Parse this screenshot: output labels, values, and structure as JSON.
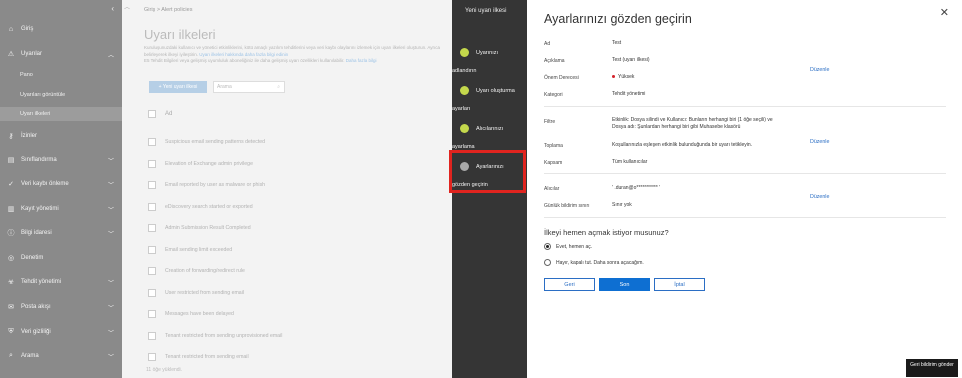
{
  "nav": {
    "items": [
      {
        "icon": "home-icon",
        "glyph": "⌂",
        "label": "Giriş"
      },
      {
        "icon": "warning-icon",
        "glyph": "⚠",
        "label": "Uyarılar"
      },
      {
        "icon": "permissions-icon",
        "glyph": "⚷",
        "label": "İzinler"
      },
      {
        "icon": "classification-icon",
        "glyph": "▤",
        "label": "Sınıflandırma"
      },
      {
        "icon": "loss-prevention-icon",
        "glyph": "✓",
        "label": "Veri kaybı önleme"
      },
      {
        "icon": "records-icon",
        "glyph": "▥",
        "label": "Kayıt yönetimi"
      },
      {
        "icon": "info-governance-icon",
        "glyph": "ⓘ",
        "label": "Bilgi idaresi"
      },
      {
        "icon": "audit-icon",
        "glyph": "◎",
        "label": "Denetim"
      },
      {
        "icon": "threat-icon",
        "glyph": "☣",
        "label": "Tehdit yönetimi"
      },
      {
        "icon": "mail-flow-icon",
        "glyph": "✉",
        "label": "Posta akışı"
      },
      {
        "icon": "privacy-icon",
        "glyph": "⛨",
        "label": "Veri gizliliği"
      },
      {
        "icon": "search-icon",
        "glyph": "⌕",
        "label": "Arama"
      }
    ],
    "sub": [
      "Pano",
      "Uyarıları görüntüle",
      "Uyarı ilkeleri"
    ]
  },
  "main": {
    "breadcrumb": "Giriş  >  Alert policies",
    "title": "Uyarı ilkeleri",
    "desc1": "Kuruluşunuzdaki kullanıcı ve yönetici etkinliklerini, kötü amaçlı yazılım tehditlerini veya veri kaybı olaylarını izlemek için uyarı ilkeleri oluşturun. Ayrıca",
    "desc2": "belirleyerek ilkeyi iyileştirin.",
    "desc_link1": "Uyarı ilkeleri hakkında daha fazla bilgi edinin",
    "desc3": "E5 Tehdit Bilgileri veya gelişmiş uyumluluk aboneliğiniz ile daha gelişmiş uyarı özellikleri kullanılabilir.",
    "desc_link2": "Daha fazla bilgi",
    "new_button": "+ Yeni uyarı ilkesi",
    "search_placeholder": "Arama",
    "column": "Ad",
    "rows": [
      "Suspicious email sending patterns detected",
      "Elevation of Exchange admin privilege",
      "Email reported by user as malware or phish",
      "eDiscovery search started or exported",
      "Admin Submission Result Completed",
      "Email sending limit exceeded",
      "Creation of forwarding/redirect rule",
      "User restricted from sending email",
      "Messages have been delayed",
      "Tenant restricted from sending unprovisioned email",
      "Tenant restricted from sending email"
    ],
    "count": "11 öğe yüklendi."
  },
  "wizard": {
    "title": "Yeni uyarı ilkesi",
    "steps": [
      {
        "label": "Uyarınızı",
        "tail": "adlandırın"
      },
      {
        "label": "Uyarı oluşturma",
        "tail": "ayarları"
      },
      {
        "label": "Alıcılarınızı",
        "tail": "ayarlama"
      },
      {
        "label": "Ayarlarınızı",
        "tail": "gözden geçirin"
      }
    ]
  },
  "review": {
    "title": "Ayarlarınızı gözden geçirin",
    "edit": "Düzenle",
    "fields": {
      "ad_label": "Ad",
      "ad": "Test",
      "aciklama_label": "Açıklama",
      "aciklama": "Test (uyarı ilkesi)",
      "onem_label": "Önem Derecesi",
      "onem": "Yüksek",
      "kategori_label": "Kategori",
      "kategori": "Tehdit yönetimi",
      "filtre_label": "Filtre",
      "filtre1": "Etkinlik: Dosya silindi ve Kullanıcı: Bunların herhangi biri (1 öğe seçili) ve",
      "filtre2": "Dosya adı: Şunlardan herhangi biri gibi Muhasebe klasörü",
      "toplama_label": "Toplama",
      "toplama": "Koşullarınızla eşleşen etkinlik bulunduğunda bir uyarı tetikleyin.",
      "kapsam_label": "Kapsam",
      "kapsam": "Tüm kullanıcılar",
      "alicilar_label": "Alıcılar",
      "alicilar": "'          .duran@o*********** '",
      "gunluk_label": "Günlük bildirim sınırı",
      "gunluk": "Sınır yok"
    },
    "question": "İlkeyi hemen açmak istiyor musunuz?",
    "opt_yes": "Evet, hemen aç.",
    "opt_no": "Hayır, kapalı tut. Daha sonra açacağım.",
    "btn_back": "Geri",
    "btn_finish": "Son",
    "btn_cancel": "İptal",
    "feedback": "Geri bildirim gönder"
  }
}
